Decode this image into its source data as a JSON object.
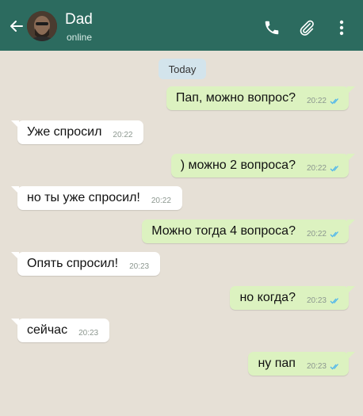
{
  "header": {
    "title": "Dad",
    "status": "online",
    "back_icon": "arrow-left-icon",
    "call_icon": "phone-icon",
    "attach_icon": "paperclip-icon",
    "menu_icon": "more-vertical-icon",
    "color": "#2c6b5f"
  },
  "chat": {
    "date_label": "Today",
    "messages": [
      {
        "direction": "out",
        "text": "Пап, можно вопрос?",
        "time": "20:22",
        "status": "read"
      },
      {
        "direction": "in",
        "text": "Уже спросил",
        "time": "20:22"
      },
      {
        "direction": "out",
        "text": ") можно 2 вопроса?",
        "time": "20:22",
        "status": "read"
      },
      {
        "direction": "in",
        "text": "но ты уже спросил!",
        "time": "20:22"
      },
      {
        "direction": "out",
        "text": "Можно тогда 4 вопроса?",
        "time": "20:22",
        "status": "read"
      },
      {
        "direction": "in",
        "text": "Опять спросил!",
        "time": "20:23"
      },
      {
        "direction": "out",
        "text": "но когда?",
        "time": "20:23",
        "status": "read"
      },
      {
        "direction": "in",
        "text": "сейчас",
        "time": "20:23"
      },
      {
        "direction": "out",
        "text": "ну пап",
        "time": "20:23",
        "status": "read"
      }
    ]
  },
  "colors": {
    "outgoing_bubble": "#dcf2c0",
    "incoming_bubble": "#ffffff",
    "background": "#e6e0d6",
    "read_ticks": "#4fb6ec"
  }
}
